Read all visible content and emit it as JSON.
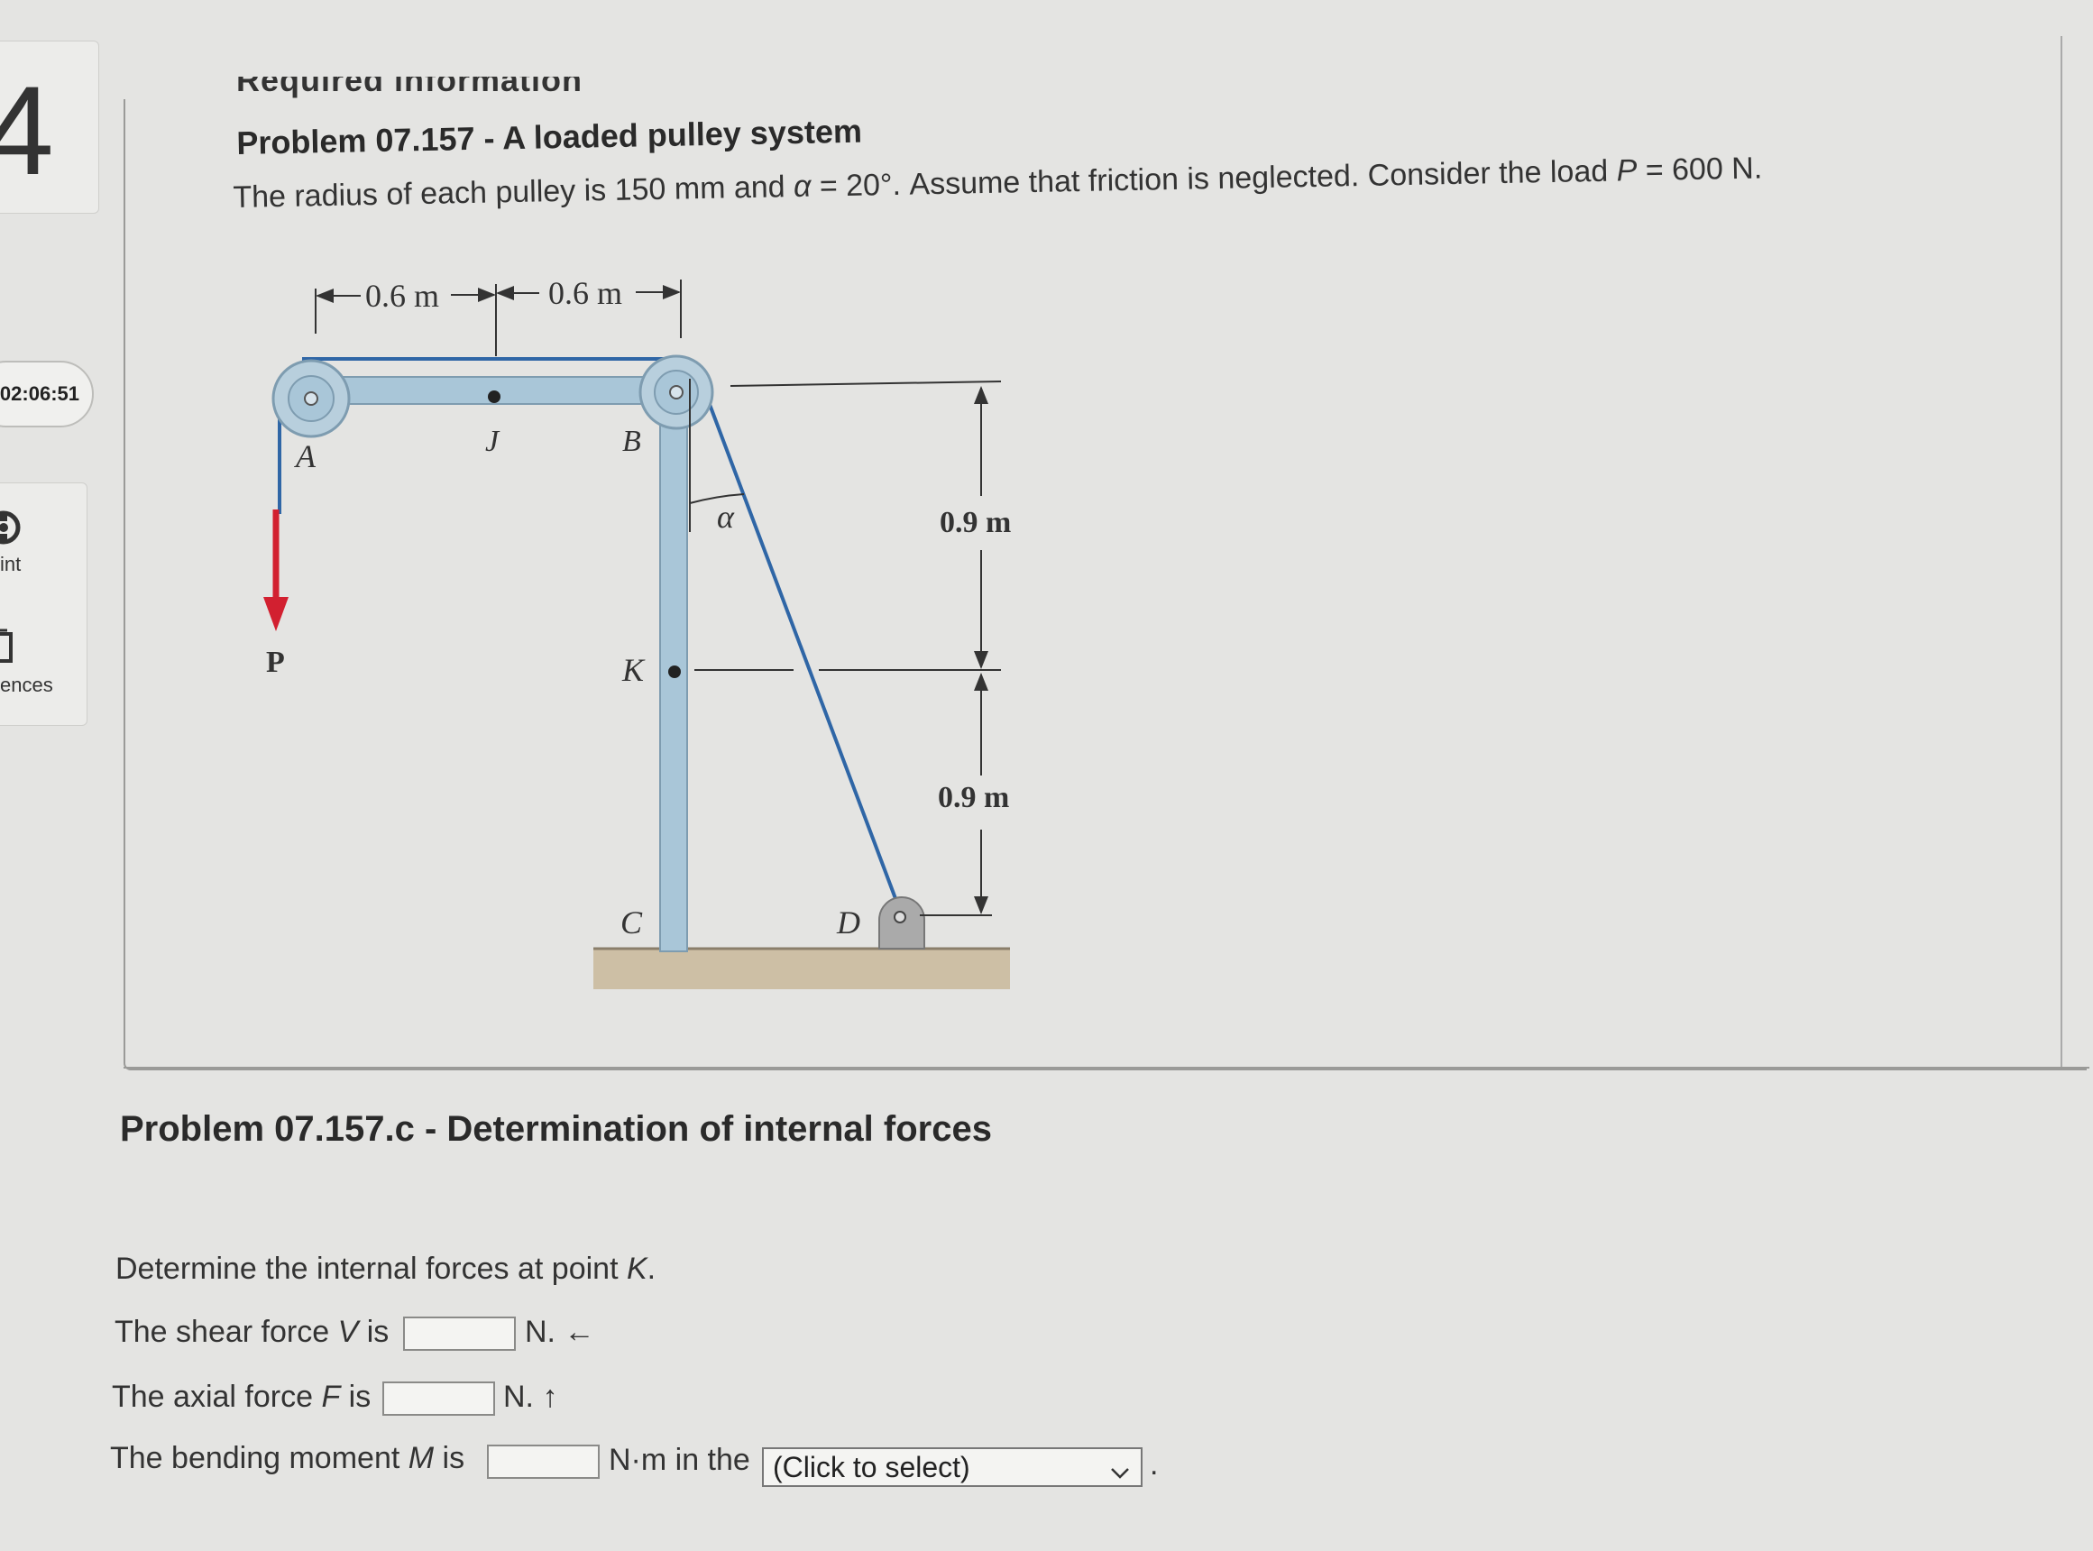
{
  "sidebar": {
    "question_number": "4",
    "timer": "02:06:51",
    "hint_label": "int",
    "references_label": "ences"
  },
  "header": {
    "cut_off_text": "Required information",
    "problem_title": "Problem 07.157 - A loaded pulley system",
    "problem_description_pre": "The radius of each pulley is 150 mm and ",
    "alpha_symbol": "α",
    "problem_description_mid": " = 20°. Assume that friction is neglected. Consider the load ",
    "p_symbol": "P",
    "problem_description_post": " = 600 N."
  },
  "diagram": {
    "dim_left": "0.6 m",
    "dim_right": "0.6 m",
    "label_A": "A",
    "label_J": "J",
    "label_B": "B",
    "label_alpha": "α",
    "label_P": "P",
    "label_K": "K",
    "label_C": "C",
    "label_D": "D",
    "dim_upper_vertical": "0.9 m",
    "dim_lower_vertical": "0.9 m",
    "colors": {
      "frame": "#a9c6d8",
      "cable": "#2f66a6",
      "load_arrow": "#d22030",
      "ground": "#cdbfa5"
    }
  },
  "part": {
    "subtitle": "Problem 07.157.c - Determination of internal forces",
    "instruction_pre": "Determine the internal forces at point ",
    "instruction_var": "K",
    "instruction_post": ".",
    "shear_pre": "The shear force ",
    "shear_var": "V",
    "shear_post": " is",
    "shear_unit": "N. ←",
    "shear_value": "",
    "axial_pre": "The axial force ",
    "axial_var": "F",
    "axial_post": " is",
    "axial_unit": "N. ↑",
    "axial_value": "",
    "moment_pre": "The bending moment ",
    "moment_var": "M",
    "moment_post": " is",
    "moment_unit": "N·m in the",
    "moment_value": "",
    "direction_select": "(Click to select)",
    "trailing_period": "."
  }
}
